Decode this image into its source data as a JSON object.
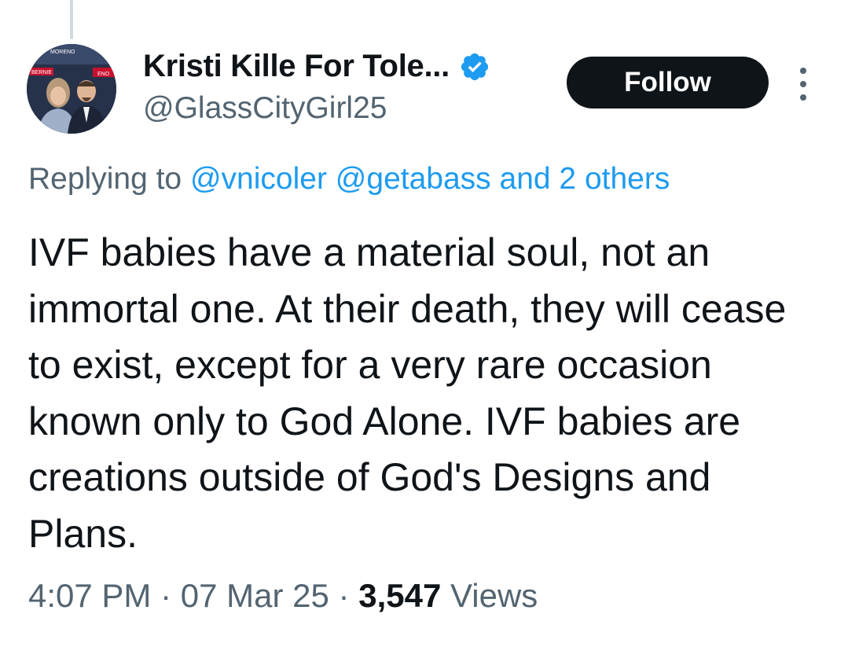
{
  "author": {
    "display_name": "Kristi Kille For Tole...",
    "handle": "@GlassCityGirl25",
    "avatar_text": [
      "BERNIE",
      "MORENO",
      "ENO"
    ]
  },
  "follow_button": {
    "label": "Follow"
  },
  "reply_context": {
    "prefix": "Replying to",
    "mentions": [
      "@vnicoler",
      "@getabass"
    ],
    "suffix": "and 2 others"
  },
  "tweet": {
    "text": "IVF babies have a material soul, not an immortal one. At their death, they will cease to exist, except for a very rare occasion known only to God Alone. IVF babies are creations outside of God's Designs and Plans."
  },
  "meta": {
    "time": "4:07 PM",
    "separator": "·",
    "date": "07 Mar 25",
    "views_count": "3,547",
    "views_label": "Views"
  },
  "colors": {
    "text_primary": "#0f1419",
    "text_secondary": "#536471",
    "link": "#1d9bf0",
    "follow_bg": "#0f1419",
    "verified": "#1d9bf0"
  }
}
